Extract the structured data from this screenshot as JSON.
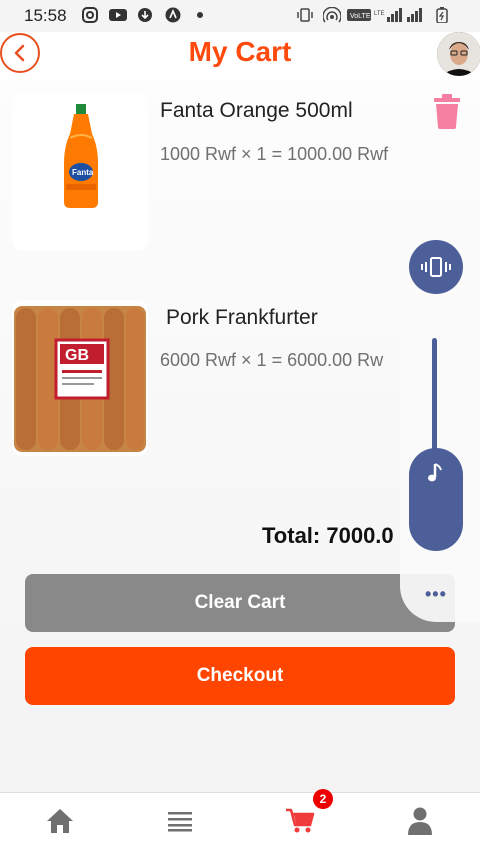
{
  "status_bar": {
    "time": "15:58",
    "icons": [
      "instagram-icon",
      "youtube-icon",
      "download-icon",
      "app-icon",
      "dot-icon",
      "vibrate-icon",
      "hotspot-icon",
      "volte-icon",
      "signal-icon",
      "battery-icon"
    ]
  },
  "header": {
    "title": "My Cart",
    "back_icon": "chevron-left-icon",
    "avatar": "user-avatar"
  },
  "cart": {
    "items": [
      {
        "name": "Fanta Orange 500ml",
        "price_line": "1000 Rwf × 1 = 1000.00 Rwf",
        "image": "fanta-bottle"
      },
      {
        "name": "Pork Frankfurter",
        "price_line": "6000 Rwf × 1 = 6000.00 Rw",
        "image": "frankfurter-pack"
      }
    ],
    "total": "Total: 7000.0"
  },
  "buttons": {
    "clear": "Clear Cart",
    "checkout": "Checkout"
  },
  "volume_panel": {
    "icons": [
      "vibrate-icon",
      "music-note-icon",
      "more-icon"
    ]
  },
  "bottom_nav": {
    "items": [
      "home",
      "list",
      "cart",
      "profile"
    ],
    "cart_badge": "2"
  },
  "colors": {
    "accent": "#ff4500",
    "title": "#ff4a0d",
    "clear_button": "#898989",
    "volume_panel": "#4d5f99",
    "trash": "#f57fa0"
  }
}
